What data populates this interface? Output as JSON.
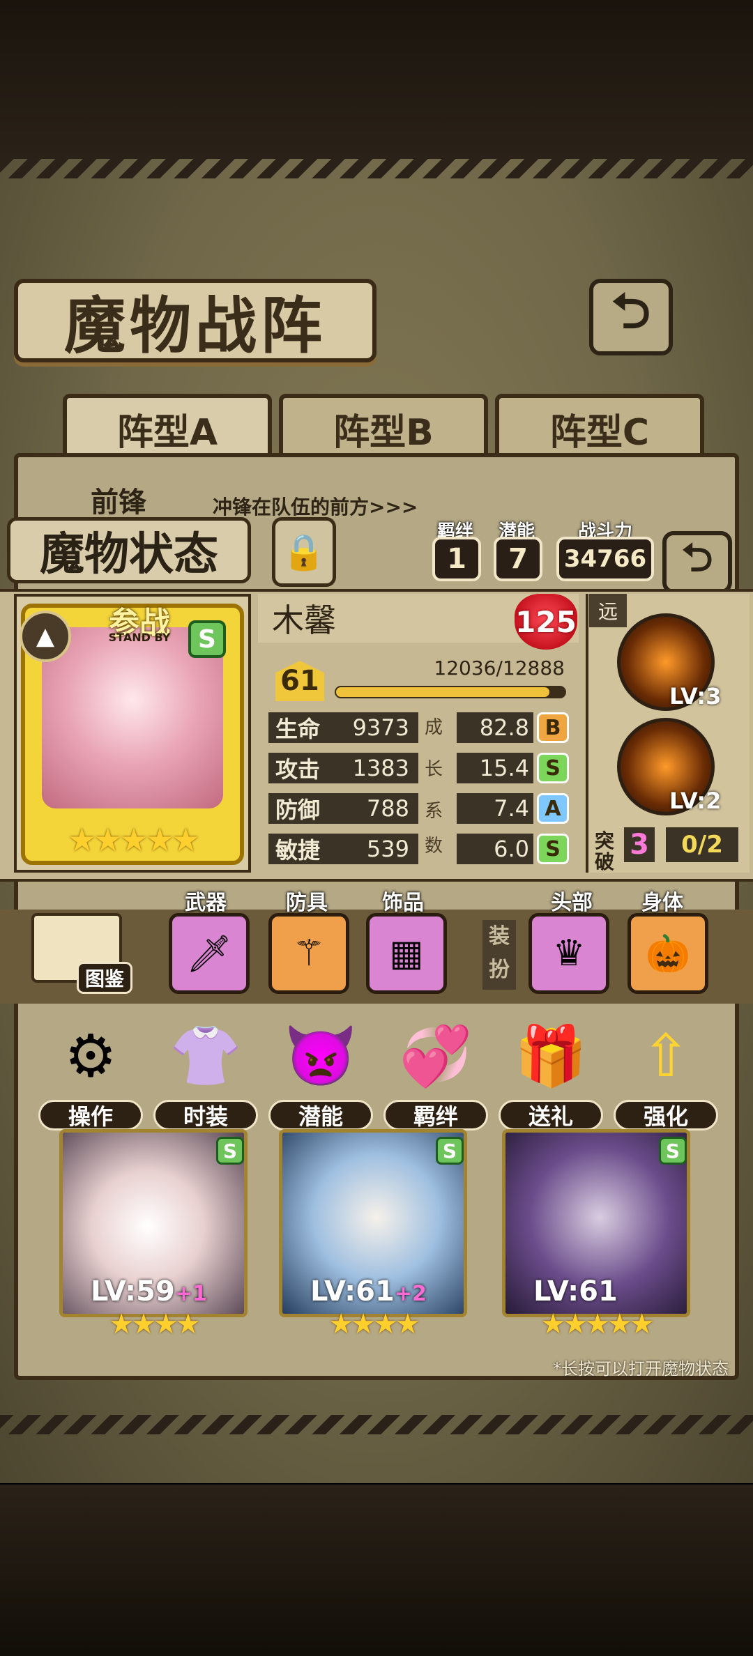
{
  "title": "魔物战阵",
  "tabs": [
    "阵型A",
    "阵型B",
    "阵型C"
  ],
  "front_label": "前锋",
  "front_desc": "冲锋在队伍的前方>>>",
  "status_title": "魔物状态",
  "bond": {
    "label": "羁绊",
    "value": "1"
  },
  "potential": {
    "label": "潜能",
    "value": "7"
  },
  "power": {
    "label": "战斗力",
    "value": "34766"
  },
  "monster": {
    "name": "木馨",
    "heart_value": "125",
    "level": "61",
    "exp_text": "12036/12888",
    "exp_fraction": 0.934,
    "standby": "参战",
    "standby_en": "STAND BY",
    "rarity": "S",
    "star_count": 5,
    "stars": "★★★★★",
    "stats": [
      {
        "label": "生命",
        "value": "9373",
        "growth": "82.8",
        "grade": "B"
      },
      {
        "label": "攻击",
        "value": "1383",
        "growth": "15.4",
        "grade": "S"
      },
      {
        "label": "防御",
        "value": "788",
        "growth": "7.4",
        "grade": "A"
      },
      {
        "label": "敏捷",
        "value": "539",
        "growth": "6.0",
        "grade": "S"
      }
    ],
    "growth_chars": [
      "成",
      "长",
      "系",
      "数"
    ],
    "range": "远",
    "skills": [
      {
        "level": "LV:3"
      },
      {
        "level": "LV:2"
      }
    ],
    "break_label_1": "突",
    "break_label_2": "破",
    "break_value": "3",
    "break_progress": "0/2"
  },
  "equipment": {
    "book_label": "图鉴",
    "weapon": "武器",
    "armor": "防具",
    "accessory": "饰品",
    "outfit_label_1": "装",
    "outfit_label_2": "扮",
    "head": "头部",
    "body": "身体"
  },
  "functions": [
    "操作",
    "时装",
    "潜能",
    "羁绊",
    "送礼",
    "强化"
  ],
  "team_slots": [
    {
      "rarity": "S",
      "level": "LV:59",
      "plus": "+1",
      "stars": "★★★★"
    },
    {
      "rarity": "S",
      "level": "LV:61",
      "plus": "+2",
      "stars": "★★★★"
    },
    {
      "rarity": "S",
      "level": "LV:61",
      "plus": "",
      "stars": "★★★★★"
    }
  ],
  "hint": "*长按可以打开魔物状态",
  "colors": {
    "grade_S": "#7bd65a",
    "grade_A": "#7fc8ff",
    "grade_B": "#f0a640",
    "heart": "#d3141f",
    "exp": "#f0c13a"
  }
}
